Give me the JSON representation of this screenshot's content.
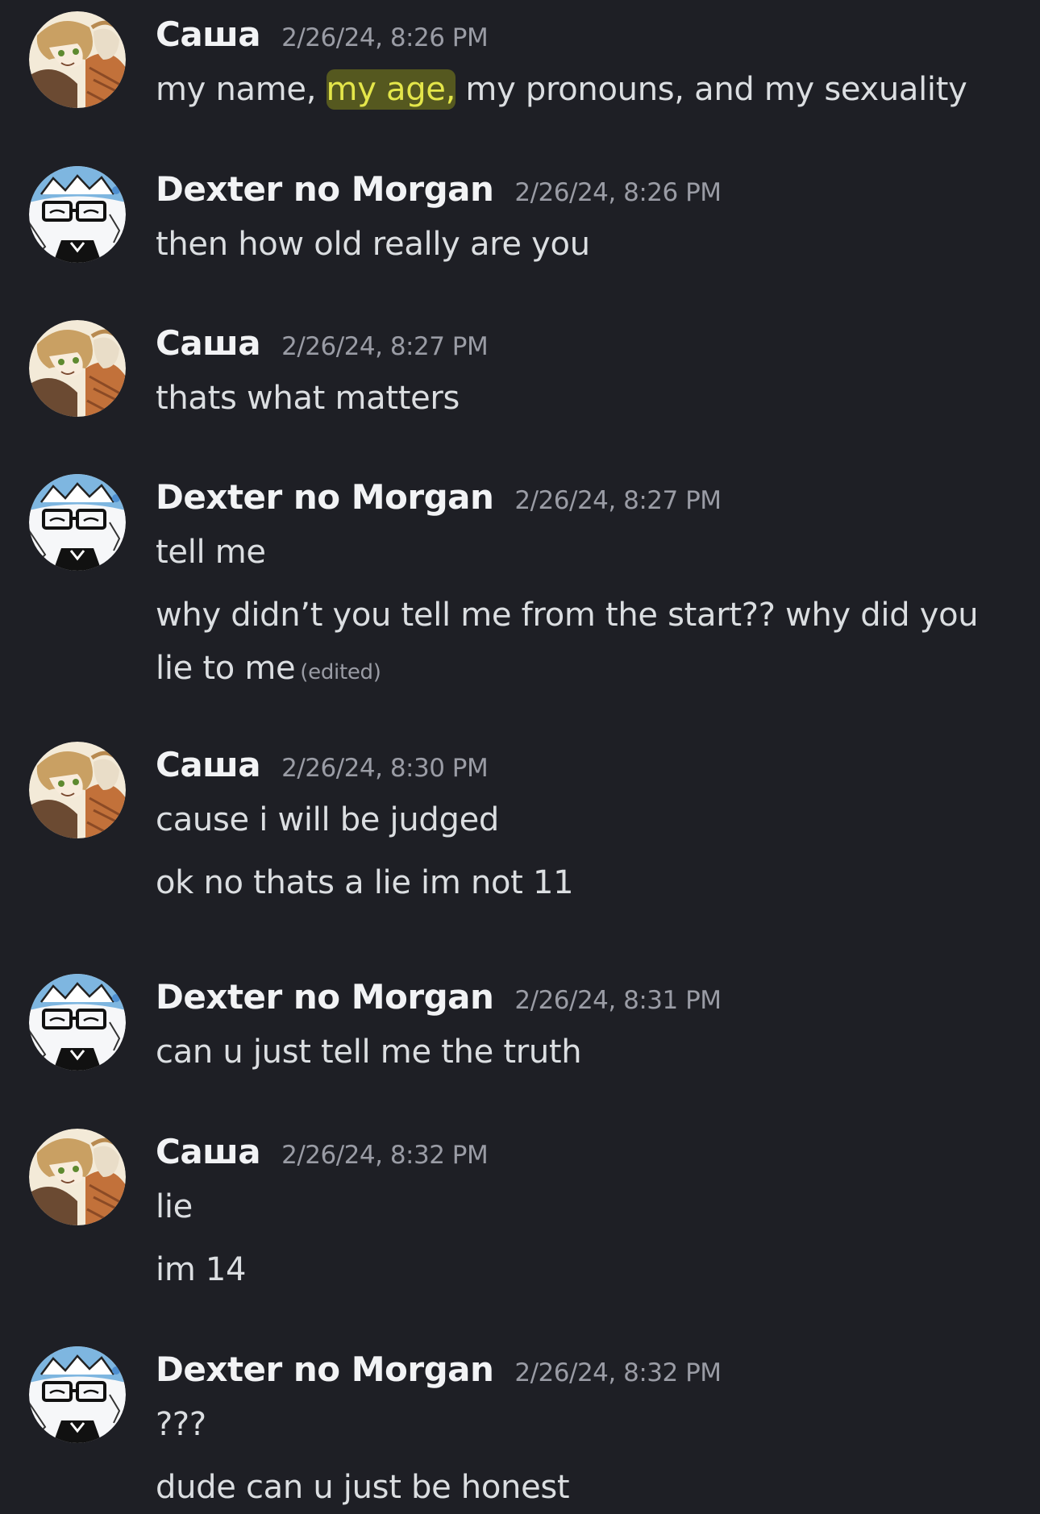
{
  "users": {
    "sasha": "Саша",
    "dexter": "Dexter no Morgan"
  },
  "messages": [
    {
      "author": "Саша",
      "time": "2/26/24, 8:26 PM",
      "line1": {
        "pre": "my name, ",
        "highlight": "my age,",
        "post": " my pronouns, and my sexuality"
      }
    },
    {
      "author": "Dexter no Morgan",
      "time": "2/26/24, 8:26 PM",
      "lines": [
        "then how old really are you"
      ]
    },
    {
      "author": "Саша",
      "time": "2/26/24, 8:27 PM",
      "lines": [
        "thats what matters"
      ]
    },
    {
      "author": "Dexter no Morgan",
      "time": "2/26/24, 8:27 PM",
      "lines": [
        "tell me",
        "why didn’t you tell me from the start?? why did you lie to me"
      ],
      "edited_label": "(edited)"
    },
    {
      "author": "Саша",
      "time": "2/26/24, 8:30 PM",
      "lines": [
        "cause i will be judged",
        "ok no thats a lie im not 11"
      ]
    },
    {
      "author": "Dexter no Morgan",
      "time": "2/26/24, 8:31 PM",
      "lines": [
        "can u just tell me the truth"
      ]
    },
    {
      "author": "Саша",
      "time": "2/26/24, 8:32 PM",
      "lines": [
        "lie",
        "im 14"
      ]
    },
    {
      "author": "Dexter no Morgan",
      "time": "2/26/24, 8:32 PM",
      "lines": [
        "???",
        "dude can u just be honest"
      ]
    }
  ],
  "colors": {
    "background": "#1e1f25",
    "username": "#f2f3f5",
    "timestamp": "#9a9ca5",
    "text": "#dbdee1",
    "highlight_text": "#e4e64a"
  },
  "icons": {
    "sasha_avatar": "anime-avatar-blonde",
    "dexter_avatar": "anime-avatar-glasses"
  }
}
